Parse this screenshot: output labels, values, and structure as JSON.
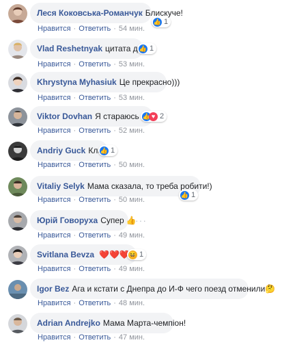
{
  "ui": {
    "like_label": "Нравится",
    "reply_label": "Ответить",
    "separator": "·"
  },
  "comments": [
    {
      "author": "Леся Коковська-Романчук",
      "text": "Блискуче!",
      "emoji": "",
      "reaction": {
        "icon": "like",
        "count": "1"
      },
      "time": "54 мин."
    },
    {
      "author": "Vlad Reshetnyak",
      "text": "цитата дня)",
      "emoji": "",
      "reaction": {
        "icon": "like",
        "count": "1"
      },
      "time": "53 мин."
    },
    {
      "author": "Khrystyna Myhasiuk",
      "text": "Це прекрасно)))",
      "emoji": "",
      "reaction": null,
      "time": "53 мин."
    },
    {
      "author": "Viktor Dovhan",
      "text": "Я стараюсь",
      "emoji": "🙇",
      "reaction": {
        "icon": "like-love",
        "count": "2"
      },
      "time": "52 мин."
    },
    {
      "author": "Andriy Guck",
      "text": "Клас",
      "emoji": "",
      "reaction": {
        "icon": "like",
        "count": "1"
      },
      "time": "50 мин."
    },
    {
      "author": "Vitaliy Selyk",
      "text": "Мама сказала, то треба робити!)",
      "emoji": "",
      "reaction": {
        "icon": "like",
        "count": "1"
      },
      "time": "50 мин."
    },
    {
      "author": "Юрій Говоруха",
      "text": "Супер",
      "emoji": "👍",
      "reaction": null,
      "time": "49 мин."
    },
    {
      "author": "Svitlana Bevza",
      "text": "",
      "emoji": "❤️❤️❤️😂",
      "reaction": {
        "icon": "haha",
        "count": "1"
      },
      "time": "49 мин."
    },
    {
      "author": "Igor Bez",
      "text": "Ага и кстати с Днепра до И-Ф чего поезд отменили",
      "emoji": "🤔",
      "reaction": null,
      "time": "48 мин."
    },
    {
      "author": "Adrian Andrejko",
      "text": "Мама Марта-чемпіон!",
      "emoji": "",
      "reaction": null,
      "time": "47 мин."
    }
  ],
  "colors": {
    "link": "#385898",
    "bubble": "#f2f3f5",
    "like": "#1877f2",
    "love": "#f33e58",
    "meta": "#90949c"
  }
}
